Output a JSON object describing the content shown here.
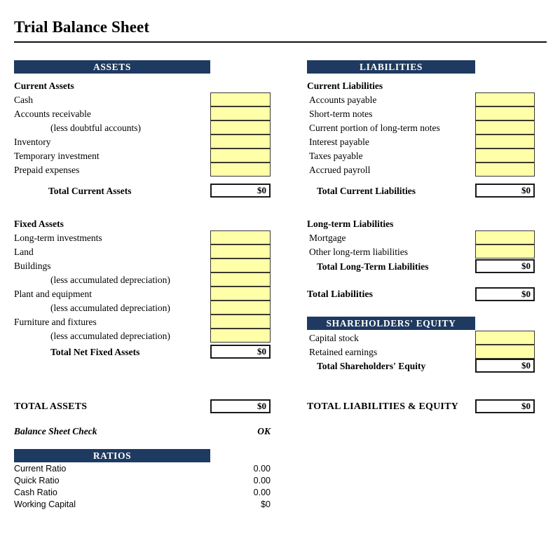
{
  "document": {
    "title": "Trial Balance Sheet"
  },
  "assets": {
    "header": "ASSETS",
    "current": {
      "heading": "Current Assets",
      "items": [
        {
          "label": "Cash",
          "value": ""
        },
        {
          "label": "Accounts receivable",
          "value": ""
        },
        {
          "label": "(less doubtful accounts)",
          "value": ""
        },
        {
          "label": "Inventory",
          "value": ""
        },
        {
          "label": "Temporary investment",
          "value": ""
        },
        {
          "label": "Prepaid expenses",
          "value": ""
        }
      ],
      "total_label": "Total Current Assets",
      "total_value": "$0"
    },
    "fixed": {
      "heading": "Fixed Assets",
      "items": [
        {
          "label": "Long-term investments",
          "value": ""
        },
        {
          "label": "Land",
          "value": ""
        },
        {
          "label": "Buildings",
          "value": ""
        },
        {
          "label": "(less accumulated depreciation)",
          "value": ""
        },
        {
          "label": "Plant and equipment",
          "value": ""
        },
        {
          "label": "(less accumulated depreciation)",
          "value": ""
        },
        {
          "label": "Furniture and fixtures",
          "value": ""
        },
        {
          "label": "(less accumulated depreciation)",
          "value": ""
        }
      ],
      "total_label": "Total Net Fixed Assets",
      "total_value": "$0"
    },
    "grand_total_label": "TOTAL ASSETS",
    "grand_total_value": "$0"
  },
  "balance_check": {
    "label": "Balance Sheet Check",
    "value": "OK"
  },
  "ratios": {
    "header": "RATIOS",
    "rows": [
      {
        "label": "Current Ratio",
        "value": "0.00"
      },
      {
        "label": "Quick Ratio",
        "value": "0.00"
      },
      {
        "label": "Cash Ratio",
        "value": "0.00"
      },
      {
        "label": "Working Capital",
        "value": "$0"
      }
    ]
  },
  "liabilities": {
    "header": "LIABILITIES",
    "current": {
      "heading": "Current Liabilities",
      "items": [
        {
          "label": "Accounts payable",
          "value": ""
        },
        {
          "label": "Short-term notes",
          "value": ""
        },
        {
          "label": "Current portion of long-term notes",
          "value": ""
        },
        {
          "label": "Interest payable",
          "value": ""
        },
        {
          "label": "Taxes payable",
          "value": ""
        },
        {
          "label": "Accrued payroll",
          "value": ""
        }
      ],
      "total_label": "Total Current Liabilities",
      "total_value": "$0"
    },
    "longterm": {
      "heading": "Long-term Liabilities",
      "items": [
        {
          "label": "Mortgage",
          "value": ""
        },
        {
          "label": "Other long-term liabilities",
          "value": ""
        }
      ],
      "total_label": "Total Long-Term Liabilities",
      "total_value": "$0"
    },
    "total_label": "Total Liabilities",
    "total_value": "$0"
  },
  "equity": {
    "header": "SHAREHOLDERS' EQUITY",
    "items": [
      {
        "label": "Capital stock",
        "value": ""
      },
      {
        "label": "Retained earnings",
        "value": ""
      }
    ],
    "total_label": "Total Shareholders' Equity",
    "total_value": "$0"
  },
  "grand": {
    "label": "TOTAL LIABILITIES & EQUITY",
    "value": "$0"
  },
  "colors": {
    "header_navy": "#1f3a60",
    "input_yellow": "#ffffa8",
    "rule_black": "#111111"
  }
}
